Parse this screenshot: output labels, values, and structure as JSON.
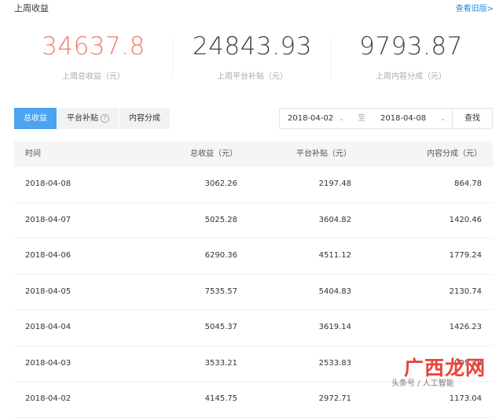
{
  "header": {
    "title": "上周收益",
    "link": "查看旧版>"
  },
  "stats": [
    {
      "value": "34637.8",
      "label": "上周总收益（元）"
    },
    {
      "value": "24843.93",
      "label": "上周平台补贴（元）"
    },
    {
      "value": "9793.87",
      "label": "上周内容分成（元）"
    }
  ],
  "tabs": [
    {
      "label": "总收益",
      "active": true
    },
    {
      "label": "平台补贴",
      "help": "?"
    },
    {
      "label": "内容分成"
    }
  ],
  "filter": {
    "start_date": "2018-04-02",
    "separator": "至",
    "end_date": "2018-04-08",
    "query_label": "查找"
  },
  "table": {
    "columns": [
      "时间",
      "总收益（元）",
      "平台补贴（元）",
      "内容分成（元）"
    ],
    "rows": [
      [
        "2018-04-08",
        "3062.26",
        "2197.48",
        "864.78"
      ],
      [
        "2018-04-07",
        "5025.28",
        "3604.82",
        "1420.46"
      ],
      [
        "2018-04-06",
        "6290.36",
        "4511.12",
        "1779.24"
      ],
      [
        "2018-04-05",
        "7535.57",
        "5404.83",
        "2130.74"
      ],
      [
        "2018-04-04",
        "5045.37",
        "3619.14",
        "1426.23"
      ],
      [
        "2018-04-03",
        "3533.21",
        "2533.83",
        "999.38"
      ],
      [
        "2018-04-02",
        "4145.75",
        "2972.71",
        "1173.04"
      ]
    ]
  },
  "watermark": {
    "site": "广西龙网",
    "caption": "头条号 / 人工智能"
  },
  "colors": {
    "accent": "#4ca3f0",
    "highlight": "#f07c6c",
    "link": "#2b85e4"
  }
}
